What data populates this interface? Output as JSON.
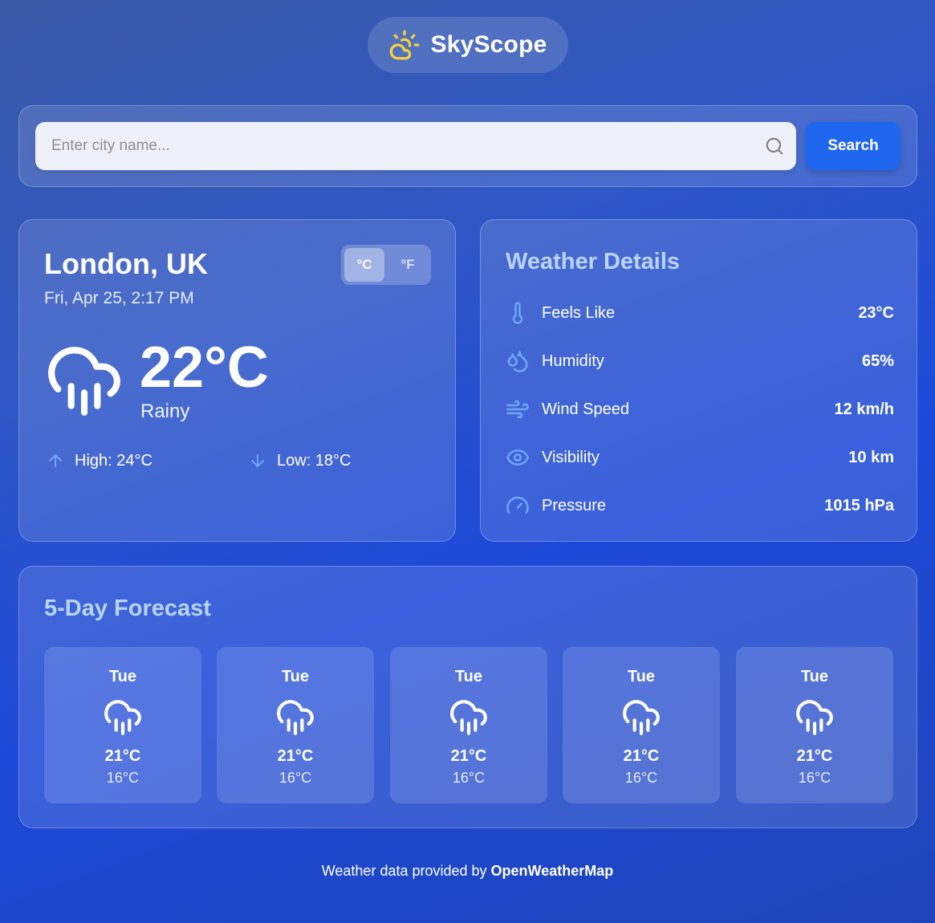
{
  "app": {
    "name": "SkyScope",
    "logo_icon": "sun-cloud-icon"
  },
  "search": {
    "placeholder": "Enter city name...",
    "value": "",
    "button_label": "Search",
    "icon": "search-icon"
  },
  "current": {
    "city": "London, UK",
    "datetime": "Fri, Apr 25, 2:17 PM",
    "units": {
      "celsius": "°C",
      "fahrenheit": "°F",
      "active": "°C"
    },
    "temperature": "22°C",
    "condition": "Rainy",
    "icon": "cloud-rain-icon",
    "high_label": "High: 24°C",
    "low_label": "Low: 18°C"
  },
  "details": {
    "title": "Weather Details",
    "items": [
      {
        "label": "Feels Like",
        "value": "23°C",
        "icon": "thermometer-icon"
      },
      {
        "label": "Humidity",
        "value": "65%",
        "icon": "droplets-icon"
      },
      {
        "label": "Wind Speed",
        "value": "12 km/h",
        "icon": "wind-icon"
      },
      {
        "label": "Visibility",
        "value": "10 km",
        "icon": "eye-icon"
      },
      {
        "label": "Pressure",
        "value": "1015 hPa",
        "icon": "gauge-icon"
      }
    ]
  },
  "forecast": {
    "title": "5-Day Forecast",
    "days": [
      {
        "day": "Tue",
        "high": "21°C",
        "low": "16°C",
        "icon": "cloud-rain-icon"
      },
      {
        "day": "Tue",
        "high": "21°C",
        "low": "16°C",
        "icon": "cloud-rain-icon"
      },
      {
        "day": "Tue",
        "high": "21°C",
        "low": "16°C",
        "icon": "cloud-rain-icon"
      },
      {
        "day": "Tue",
        "high": "21°C",
        "low": "16°C",
        "icon": "cloud-rain-icon"
      },
      {
        "day": "Tue",
        "high": "21°C",
        "low": "16°C",
        "icon": "cloud-rain-icon"
      }
    ]
  },
  "footer": {
    "prefix": "Weather data provided by",
    "source": "OpenWeatherMap"
  },
  "colors": {
    "accent_button": "#1f66ee",
    "section_title": "#b8d4ff",
    "icon_blue": "#6fa6ff",
    "logo_yellow": "#f5cf3b"
  }
}
